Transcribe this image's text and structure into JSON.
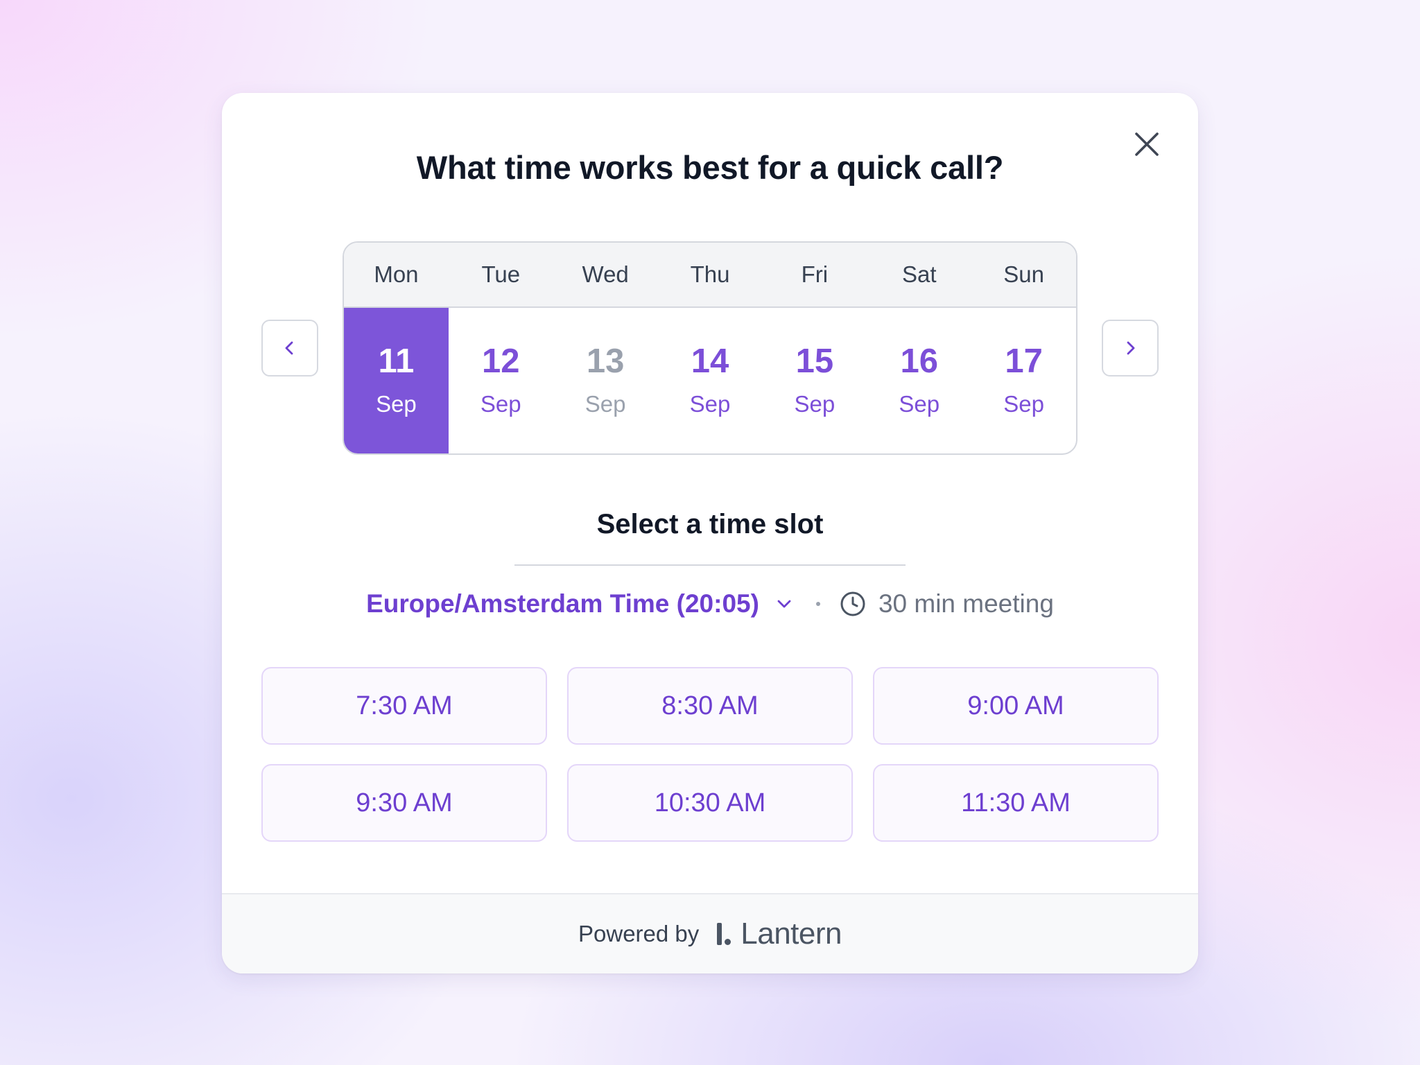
{
  "modal": {
    "title": "What time works best for a quick call?",
    "close_icon": "close-icon"
  },
  "calendar": {
    "prev_icon": "chevron-left-icon",
    "next_icon": "chevron-right-icon",
    "weekdays": [
      "Mon",
      "Tue",
      "Wed",
      "Thu",
      "Fri",
      "Sat",
      "Sun"
    ],
    "days": [
      {
        "num": "11",
        "month": "Sep",
        "state": "selected"
      },
      {
        "num": "12",
        "month": "Sep",
        "state": "available"
      },
      {
        "num": "13",
        "month": "Sep",
        "state": "disabled"
      },
      {
        "num": "14",
        "month": "Sep",
        "state": "available"
      },
      {
        "num": "15",
        "month": "Sep",
        "state": "available"
      },
      {
        "num": "16",
        "month": "Sep",
        "state": "available"
      },
      {
        "num": "17",
        "month": "Sep",
        "state": "available"
      }
    ]
  },
  "slots_section": {
    "heading": "Select a time slot",
    "timezone_label": "Europe/Amsterdam Time (20:05)",
    "timezone_icon": "chevron-down-icon",
    "duration_icon": "clock-icon",
    "duration_label": "30 min meeting",
    "slots": [
      "7:30 AM",
      "8:30 AM",
      "9:00 AM",
      "9:30 AM",
      "10:30 AM",
      "11:30 AM"
    ]
  },
  "footer": {
    "powered_by": "Powered by",
    "brand": "Lantern"
  },
  "colors": {
    "accent": "#7d55d9",
    "accent_text": "#6d3fd0",
    "disabled": "#9aa1ad",
    "heading": "#111827"
  }
}
